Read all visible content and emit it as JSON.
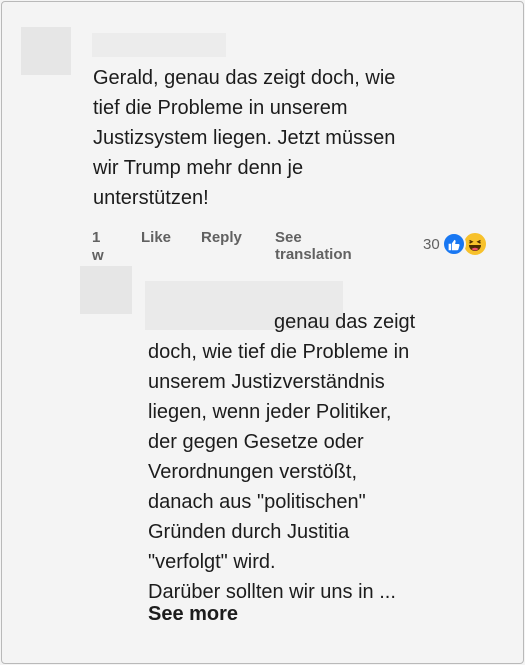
{
  "comment1": {
    "lines": [
      "Gerald, genau das zeigt doch, wie",
      "tief die Probleme in unserem",
      "Justizsystem liegen. Jetzt müssen",
      "wir Trump mehr denn je",
      "unterstützen!"
    ],
    "time_number": "1",
    "time_unit": "w",
    "like_label": "Like",
    "reply_label": "Reply",
    "translate_line1": "See",
    "translate_line2": "translation",
    "reaction_count": "30",
    "reaction_icons": [
      "like-icon",
      "haha-icon"
    ],
    "colors": {
      "like": "#1877f2",
      "haha": "#f7c12b"
    }
  },
  "comment2": {
    "lines": [
      "genau das zeigt",
      "doch, wie tief die Probleme in",
      "unserem Justizverständnis",
      "liegen, wenn jeder Politiker,",
      "der gegen Gesetze oder",
      "Verordnungen verstößt,",
      "danach aus \"politischen\"",
      "Gründen durch Justitia",
      "\"verfolgt\" wird.",
      "Darüber sollten wir uns in ..."
    ],
    "see_more_label": "See more"
  }
}
